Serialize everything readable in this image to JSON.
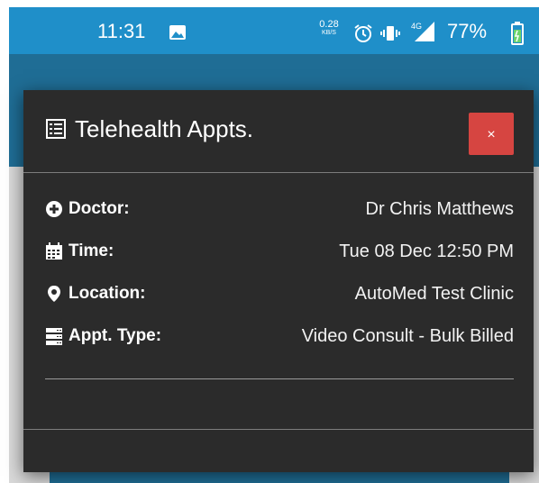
{
  "status_bar": {
    "time": "11:31",
    "network_speed_value": "0.28",
    "network_speed_unit": "KB/S",
    "signal_label": "4G",
    "battery_percent": "77%",
    "icons": [
      "gallery-icon",
      "alarm-icon",
      "vibrate-icon",
      "signal-icon",
      "battery-charging-icon"
    ]
  },
  "modal": {
    "title": "Telehealth Appts.",
    "title_icon": "list-icon",
    "close_label": "×",
    "rows": [
      {
        "icon": "plus-circle-icon",
        "label": "Doctor:",
        "value": "Dr Chris Matthews"
      },
      {
        "icon": "calendar-icon",
        "label": "Time:",
        "value": "Tue 08 Dec 12:50 PM"
      },
      {
        "icon": "map-marker-icon",
        "label": "Location:",
        "value": "AutoMed Test Clinic"
      },
      {
        "icon": "server-icon",
        "label": "Appt. Type:",
        "value": "Video Consult - Bulk Billed"
      }
    ]
  },
  "colors": {
    "status_bar": "#1f8fc9",
    "app_header": "#1f6d95",
    "modal_background": "#2b2b2b",
    "close_button": "#d64541"
  }
}
